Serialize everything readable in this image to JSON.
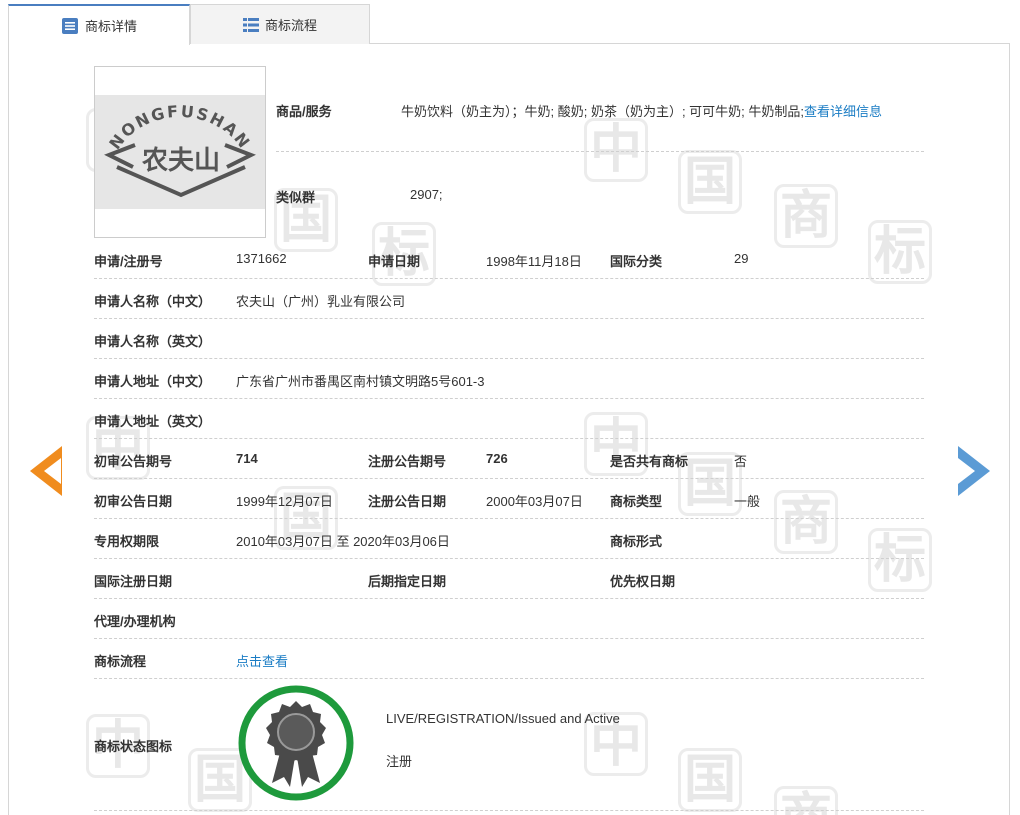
{
  "tabs": [
    {
      "label": "商标详情",
      "icon": "document-list-icon",
      "active": true
    },
    {
      "label": "商标流程",
      "icon": "list-grid-icon",
      "active": false
    }
  ],
  "watermark": [
    "中",
    "国",
    "商",
    "标"
  ],
  "logo": {
    "arc_text": "NONGFUSHAN",
    "mark_text": "农夫山"
  },
  "goods": {
    "label": "商品/服务",
    "value": "牛奶饮料（奶主为）；牛奶; 酸奶; 奶茶（奶为主）; 可可牛奶; 牛奶制品;",
    "link": "查看详细信息"
  },
  "similar_group": {
    "label": "类似群",
    "value": "2907;"
  },
  "fields": {
    "reg_no_label": "申请/注册号",
    "reg_no": "1371662",
    "app_date_label": "申请日期",
    "app_date": "1998年11月18日",
    "intl_class_label": "国际分类",
    "intl_class": "29",
    "applicant_cn_label": "申请人名称（中文）",
    "applicant_cn": "农夫山（广州）乳业有限公司",
    "applicant_en_label": "申请人名称（英文）",
    "applicant_en": "",
    "address_cn_label": "申请人地址（中文）",
    "address_cn": "广东省广州市番禺区南村镇文明路5号601-3",
    "address_en_label": "申请人地址（英文）",
    "address_en": "",
    "prelim_issue_label": "初审公告期号",
    "prelim_issue": "714",
    "reg_issue_label": "注册公告期号",
    "reg_issue": "726",
    "shared_label": "是否共有商标",
    "shared": "否",
    "prelim_date_label": "初审公告日期",
    "prelim_date": "1999年12月07日",
    "reg_date_label": "注册公告日期",
    "reg_date": "2000年03月07日",
    "tm_type_label": "商标类型",
    "tm_type": "一般",
    "term_label": "专用权期限",
    "term": "2010年03月07日 至 2020年03月06日",
    "tm_form_label": "商标形式",
    "tm_form": "",
    "intl_reg_date_label": "国际注册日期",
    "intl_reg_date": "",
    "later_designation_label": "后期指定日期",
    "later_designation": "",
    "priority_date_label": "优先权日期",
    "priority_date": "",
    "agent_label": "代理/办理机构",
    "agent": "",
    "process_label": "商标流程",
    "process_link": "点击查看",
    "status_label": "商标状态图标",
    "status_en": "LIVE/REGISTRATION/Issued and Active",
    "status_cn": "注册"
  },
  "colors": {
    "tab_accent": "#4a7ec0",
    "link": "#1a7cc4",
    "prev_arrow": "#f08c1e",
    "next_arrow": "#5b9bd5",
    "status_ring": "#1e9a3c",
    "status_badge": "#4a4a4a"
  }
}
